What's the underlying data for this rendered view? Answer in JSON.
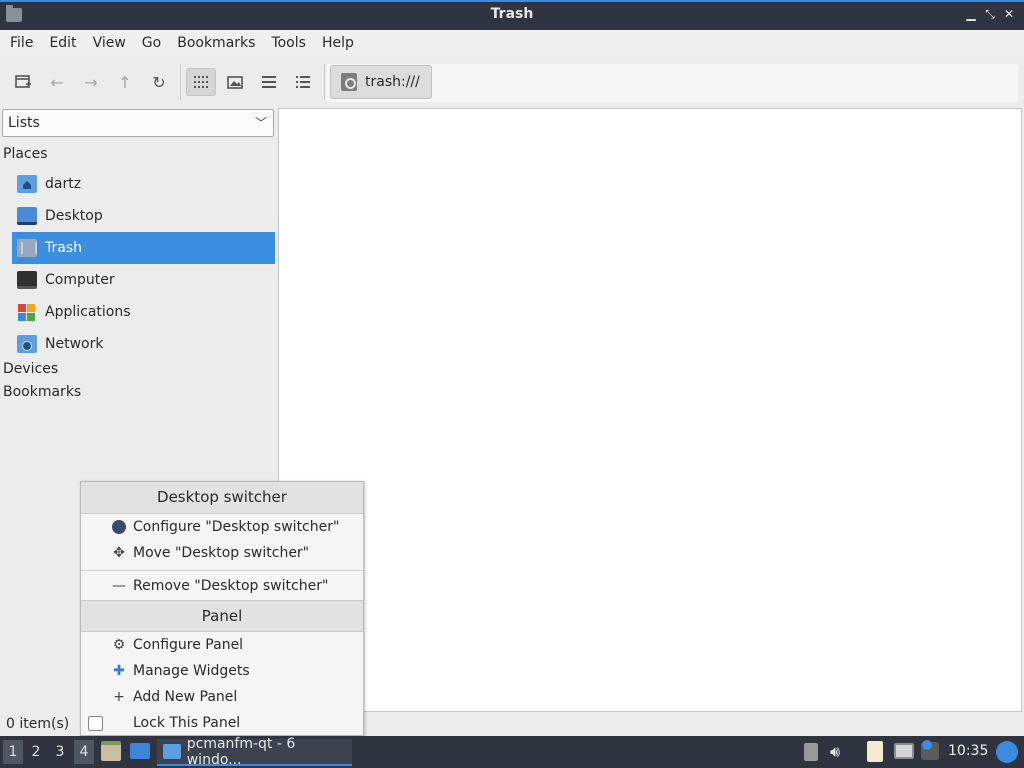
{
  "window": {
    "title": "Trash"
  },
  "menubar": {
    "items": [
      "File",
      "Edit",
      "View",
      "Go",
      "Bookmarks",
      "Tools",
      "Help"
    ]
  },
  "toolbar": {
    "path": "trash:///"
  },
  "sidebar": {
    "view_select": "Lists",
    "places_label": "Places",
    "places": [
      "dartz",
      "Desktop",
      "Trash",
      "Computer",
      "Applications",
      "Network"
    ],
    "selected": "Trash",
    "devices_label": "Devices",
    "bookmarks_label": "Bookmarks"
  },
  "statusbar": {
    "items": "0 item(s)"
  },
  "context_menu": {
    "widget_header": "Desktop switcher",
    "configure_widget": "Configure \"Desktop switcher\"",
    "move_widget": "Move \"Desktop switcher\"",
    "remove_widget": "Remove \"Desktop switcher\"",
    "panel_header": "Panel",
    "configure_panel": "Configure Panel",
    "manage_widgets": "Manage Widgets",
    "add_panel": "Add New Panel",
    "lock_panel": "Lock This Panel"
  },
  "taskbar": {
    "desktops": [
      "1",
      "2",
      "3",
      "4"
    ],
    "task": "pcmanfm-qt - 6 windo...",
    "clock": "10:35"
  },
  "colors": {
    "accent": "#3b8ee0",
    "taskbar": "#2f3440"
  }
}
